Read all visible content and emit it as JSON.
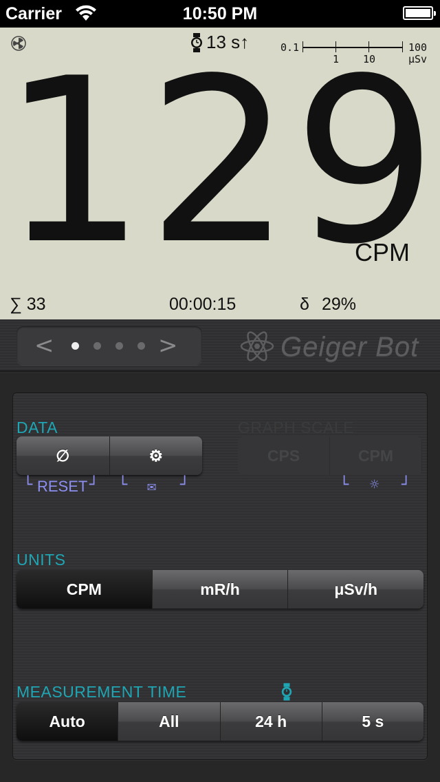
{
  "status_bar": {
    "carrier": "Carrier",
    "time": "10:50 PM"
  },
  "display": {
    "interval": "13 s↑",
    "scale": {
      "min": "0.1",
      "tick1": "1",
      "tick2": "10",
      "max": "100",
      "unit": "μSv"
    },
    "reading": "129",
    "unit": "CPM",
    "sum_label": "∑ 33",
    "elapsed": "00:00:15",
    "error_label": "δ",
    "error_value": "29%"
  },
  "nav": {
    "prev": "<",
    "next": ">",
    "page_count": 4,
    "active_page": 0,
    "brand": "Geiger Bot"
  },
  "data_section": {
    "label": "DATA",
    "reset_symbol": "∅",
    "settings_symbol": "⚙",
    "reset_caption": "RESET",
    "mail_symbol": "✉"
  },
  "graph_scale": {
    "label": "GRAPH SCALE",
    "options": [
      "CPS",
      "CPM"
    ],
    "brightness_symbol": "☼"
  },
  "units": {
    "label": "UNITS",
    "options": [
      "CPM",
      "mR/h",
      "μSv/h"
    ],
    "selected": 0
  },
  "measurement_time": {
    "label": "MEASUREMENT TIME",
    "options": [
      "Auto",
      "All",
      "24 h",
      "5 s"
    ],
    "selected": 0
  },
  "colors": {
    "accent": "#1fa6b4",
    "lcd_bg": "#d8d9c8",
    "caption": "#8c8ff0"
  }
}
